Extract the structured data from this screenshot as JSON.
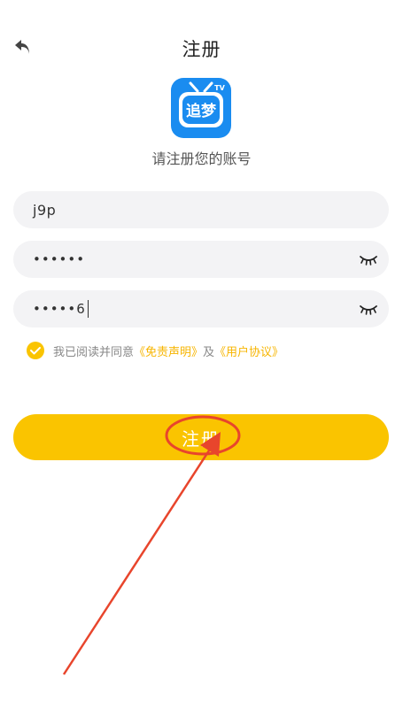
{
  "header": {
    "title": "注册",
    "back_icon": "back-arrow-icon"
  },
  "logo": {
    "text": "追梦",
    "badge": "TV",
    "color": "#1a8cf0"
  },
  "subtitle": "请注册您的账号",
  "form": {
    "username": "j9p",
    "password": "••••••",
    "confirm_password": "•••••6",
    "eye_icon": "eye-closed-icon"
  },
  "agreement": {
    "prefix": "我已阅读并同意",
    "disclaimer": "《免责声明》",
    "and": "及",
    "user_agreement": "《用户协议》",
    "checked": true
  },
  "submit": {
    "label": "注册"
  },
  "colors": {
    "accent": "#fac400",
    "link": "#f7b500",
    "annotation": "#e8452c"
  }
}
